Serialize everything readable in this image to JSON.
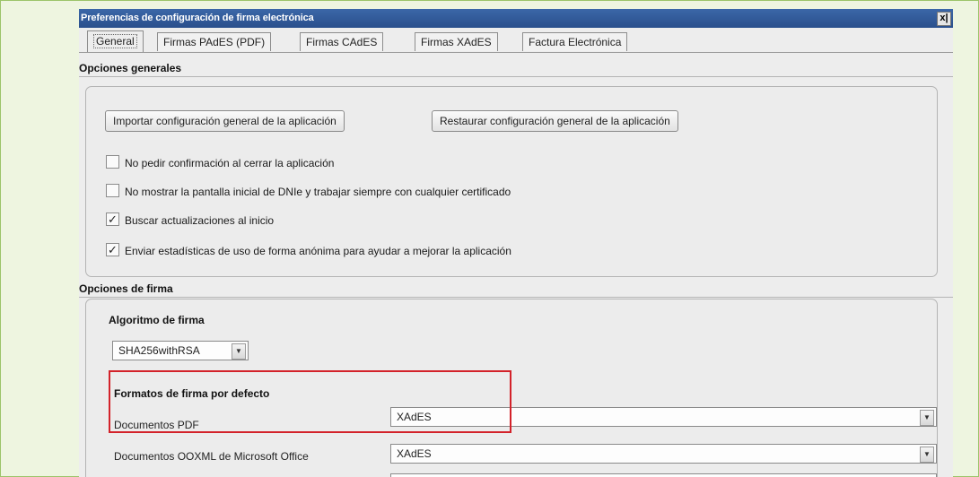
{
  "window": {
    "title": "Preferencias de configuración de firma electrónica",
    "close_label": "x|"
  },
  "tabs": [
    {
      "label": "General",
      "active": true
    },
    {
      "label": "Firmas PAdES (PDF)",
      "active": false
    },
    {
      "label": "Firmas CAdES",
      "active": false
    },
    {
      "label": "Firmas XAdES",
      "active": false
    },
    {
      "label": "Factura Electrónica",
      "active": false
    }
  ],
  "general": {
    "section_title": "Opciones generales",
    "import_button": "Importar configuración general de la aplicación",
    "restore_button": "Restaurar configuración general de la aplicación",
    "checkboxes": [
      {
        "label": "No pedir confirmación al cerrar la aplicación",
        "checked": false
      },
      {
        "label": "No mostrar la pantalla inicial de DNIe y trabajar siempre con cualquier certificado",
        "checked": false
      },
      {
        "label": "Buscar actualizaciones al inicio",
        "checked": true
      },
      {
        "label": "Enviar estadísticas de uso de forma anónima para ayudar a mejorar la aplicación",
        "checked": true
      }
    ]
  },
  "signature": {
    "section_title": "Opciones de firma",
    "algorithm_label": "Algoritmo de firma",
    "algorithm_value": "SHA256withRSA",
    "default_formats_label": "Formatos de firma por defecto",
    "formats": [
      {
        "label": "Documentos PDF",
        "value": "XAdES"
      },
      {
        "label": "Documentos OOXML de Microsoft Office",
        "value": "XAdES"
      }
    ]
  },
  "colors": {
    "titlebar": "#2a4f8c",
    "highlight": "#d3222a",
    "page_border": "#9cc46a"
  }
}
